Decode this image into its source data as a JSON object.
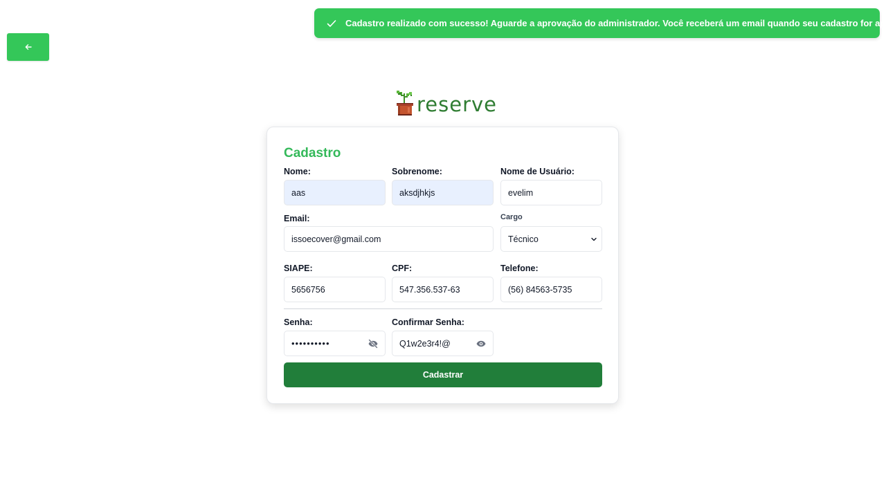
{
  "toast": {
    "message": "Cadastro realizado com sucesso! Aguarde a aprovação do administrador. Você receberá um email quando seu cadastro for aprovado."
  },
  "brand": {
    "name": "reserve"
  },
  "form": {
    "title": "Cadastro",
    "fields": {
      "nome": {
        "label": "Nome:",
        "value": "aas"
      },
      "sobrenome": {
        "label": "Sobrenome:",
        "value": "aksdjhkjs"
      },
      "usuario": {
        "label": "Nome de Usuário:",
        "value": "evelim"
      },
      "email": {
        "label": "Email:",
        "value": "issoecover@gmail.com"
      },
      "cargo": {
        "label": "Cargo",
        "value": "Técnico"
      },
      "siape": {
        "label": "SIAPE:",
        "value": "5656756"
      },
      "cpf": {
        "label": "CPF:",
        "value": "547.356.537-63"
      },
      "telefone": {
        "label": "Telefone:",
        "value": "(56) 84563-5735"
      },
      "senha": {
        "label": "Senha:",
        "value": "••••••••••"
      },
      "confirmar_senha": {
        "label": "Confirmar Senha:",
        "value": "Q1w2e3r4!@"
      }
    },
    "submit_label": "Cadastrar"
  },
  "colors": {
    "accent": "#34c759",
    "primary_button": "#217e3a",
    "title": "#34b95a",
    "autofill": "#e8f0fe"
  },
  "icons": {
    "back": "arrow-left-icon",
    "toast_check": "check-icon",
    "toast_close": "close-icon",
    "password_hidden": "eye-off-icon",
    "password_visible": "eye-icon",
    "select": "chevron-down-icon"
  }
}
